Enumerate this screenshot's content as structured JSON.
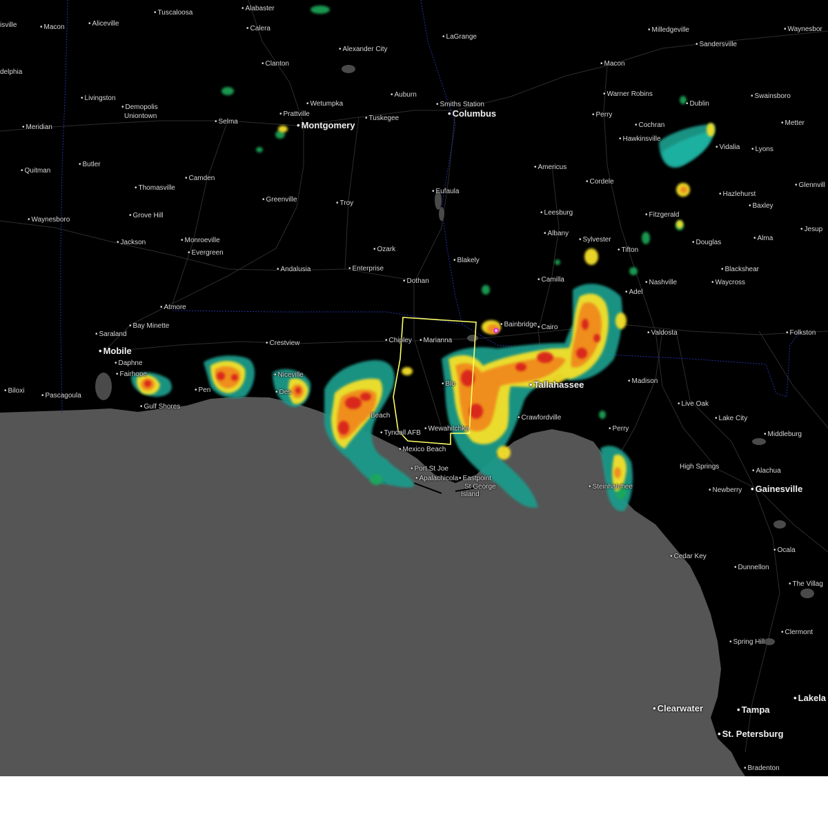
{
  "map": {
    "colors": {
      "land": "#000000",
      "water": "#555555",
      "roads": "#3a3a3a",
      "state_borders": "#2233aa",
      "warning_polygon": "#ffff66",
      "radar_light": "#1a9a8a",
      "radar_green": "#1fa85a",
      "radar_yellow": "#f5e02a",
      "radar_orange": "#f08a1c",
      "radar_red": "#d8231f",
      "radar_magenta": "#e23ad6"
    },
    "cities": [
      {
        "name": "isville"
      },
      {
        "name": "Macon"
      },
      {
        "name": "Aliceville"
      },
      {
        "name": "Tuscaloosa"
      },
      {
        "name": "Alabaster"
      },
      {
        "name": "Calera"
      },
      {
        "name": "Alexander City"
      },
      {
        "name": "LaGrange"
      },
      {
        "name": "Milledgeville"
      },
      {
        "name": "Waynesbor"
      },
      {
        "name": "Sandersville"
      },
      {
        "name": "delphia"
      },
      {
        "name": "Clanton"
      },
      {
        "name": "Macon"
      },
      {
        "name": "Livingston"
      },
      {
        "name": "Demopolis"
      },
      {
        "name": "Uniontown"
      },
      {
        "name": "Wetumpka"
      },
      {
        "name": "Auburn"
      },
      {
        "name": "Smiths Station"
      },
      {
        "name": "Warner Robins"
      },
      {
        "name": "Swainsboro"
      },
      {
        "name": "Prattville"
      },
      {
        "name": "Columbus"
      },
      {
        "name": "Tuskegee"
      },
      {
        "name": "Perry"
      },
      {
        "name": "Dublin"
      },
      {
        "name": "Meridian"
      },
      {
        "name": "Selma"
      },
      {
        "name": "Montgomery"
      },
      {
        "name": "Cochran"
      },
      {
        "name": "Metter"
      },
      {
        "name": "Hawkinsville"
      },
      {
        "name": "Vidalia"
      },
      {
        "name": "Lyons"
      },
      {
        "name": "Butler"
      },
      {
        "name": "Quitman"
      },
      {
        "name": "Camden"
      },
      {
        "name": "Americus"
      },
      {
        "name": "Cordele"
      },
      {
        "name": "Thomasville"
      },
      {
        "name": "Eufaula"
      },
      {
        "name": "Hazlehurst"
      },
      {
        "name": "Glennvill"
      },
      {
        "name": "Greenville"
      },
      {
        "name": "Troy"
      },
      {
        "name": "Baxley"
      },
      {
        "name": "Grove Hill"
      },
      {
        "name": "Leesburg"
      },
      {
        "name": "Fitzgerald"
      },
      {
        "name": "Waynesboro"
      },
      {
        "name": "Albany"
      },
      {
        "name": "Jackson"
      },
      {
        "name": "Monroeville"
      },
      {
        "name": "Sylvester"
      },
      {
        "name": "Alma"
      },
      {
        "name": "Douglas"
      },
      {
        "name": "Jesup"
      },
      {
        "name": "Ozark"
      },
      {
        "name": "Evergreen"
      },
      {
        "name": "Tifton"
      },
      {
        "name": "Blakely"
      },
      {
        "name": "Andalusia"
      },
      {
        "name": "Enterprise"
      },
      {
        "name": "Blackshear"
      },
      {
        "name": "Camilla"
      },
      {
        "name": "Dothan"
      },
      {
        "name": "Waycross"
      },
      {
        "name": "Nashville"
      },
      {
        "name": "Adel"
      },
      {
        "name": "Atmore"
      },
      {
        "name": "Bainbridge"
      },
      {
        "name": "Cairo"
      },
      {
        "name": "Bay Minette"
      },
      {
        "name": "Valdosta"
      },
      {
        "name": "Folkston"
      },
      {
        "name": "Saraland"
      },
      {
        "name": "Marianna"
      },
      {
        "name": "Chipley"
      },
      {
        "name": "Crestview"
      },
      {
        "name": "Mobile"
      },
      {
        "name": "Daphne"
      },
      {
        "name": "Fairhope"
      },
      {
        "name": "Tallahassee"
      },
      {
        "name": "Madison"
      },
      {
        "name": "Niceville"
      },
      {
        "name": "Biloxi"
      },
      {
        "name": "Pascagoula"
      },
      {
        "name": "Gulf Shores"
      },
      {
        "name": "Live Oak"
      },
      {
        "name": "Lake City"
      },
      {
        "name": "Crawfordville"
      },
      {
        "name": "Middleburg"
      },
      {
        "name": "Tyndall AFB"
      },
      {
        "name": "Wewahitchka"
      },
      {
        "name": "Perry"
      },
      {
        "name": "Mexico Beach"
      },
      {
        "name": "High Springs"
      },
      {
        "name": "Alachua"
      },
      {
        "name": "Port St Joe"
      },
      {
        "name": "Eastpoint"
      },
      {
        "name": "Apalachicola"
      },
      {
        "name": "St George"
      },
      {
        "name": "Island"
      },
      {
        "name": "Newberry"
      },
      {
        "name": "Gainesville"
      },
      {
        "name": "Steinhatchee"
      },
      {
        "name": "Cedar Key"
      },
      {
        "name": "Ocala"
      },
      {
        "name": "Dunnellon"
      },
      {
        "name": "The Villag"
      },
      {
        "name": "Clermont"
      },
      {
        "name": "Spring Hill"
      },
      {
        "name": "Clearwater"
      },
      {
        "name": "Tampa"
      },
      {
        "name": "Lakela"
      },
      {
        "name": "St. Petersburg"
      },
      {
        "name": "Bradenton"
      },
      {
        "name": "Pen"
      },
      {
        "name": "Des"
      },
      {
        "name": "Beach"
      },
      {
        "name": "Blo"
      }
    ]
  }
}
